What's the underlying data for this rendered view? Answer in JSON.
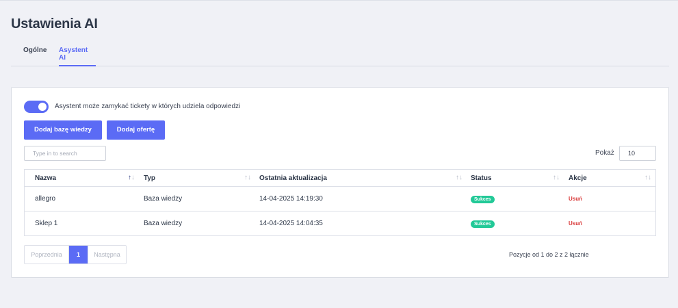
{
  "page": {
    "title": "Ustawienia AI"
  },
  "tabs": [
    {
      "label": "Ogólne",
      "active": false
    },
    {
      "label": "Asystent AI",
      "active": true
    }
  ],
  "settings": {
    "toggle_label": "Asystent może zamykać tickety w których udziela odpowiedzi",
    "toggle_on": true
  },
  "actions": {
    "add_knowledge_base": "Dodaj bazę wiedzy",
    "add_offer": "Dodaj ofertę"
  },
  "search": {
    "placeholder": "Type in to search",
    "value": ""
  },
  "page_size": {
    "label": "Pokaż",
    "value": "10"
  },
  "table": {
    "columns": [
      "Nazwa",
      "Typ",
      "Ostatnia aktualizacja",
      "Status",
      "Akcje"
    ],
    "sorted_column": "Nazwa",
    "rows": [
      {
        "name": "allegro",
        "type": "Baza wiedzy",
        "updated": "14-04-2025 14:19:30",
        "status": "Sukces",
        "action": "Usuń"
      },
      {
        "name": "Sklep 1",
        "type": "Baza wiedzy",
        "updated": "14-04-2025 14:04:35",
        "status": "Sukces",
        "action": "Usuń"
      }
    ]
  },
  "pagination": {
    "prev": "Poprzednia",
    "current": "1",
    "next": "Następna",
    "info": "Pozycje od 1 do 2 z 2 łącznie"
  },
  "colors": {
    "accent": "#5b6bf5",
    "success": "#22c997",
    "danger": "#d93b3b",
    "background": "#f0f1f6"
  },
  "icons": {
    "sort": "sort-arrows-icon",
    "sort_active": "sort-asc-icon"
  }
}
